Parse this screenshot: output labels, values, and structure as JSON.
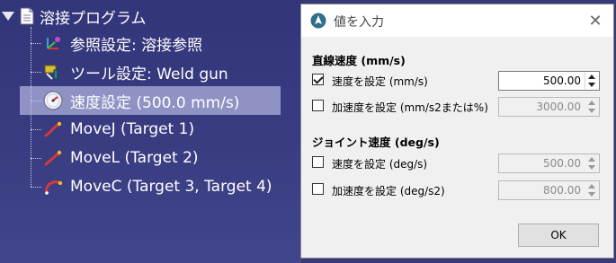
{
  "tree": {
    "root_label": "溶接プログラム",
    "items": [
      {
        "label": "参照設定: 溶接参照",
        "icon": "reference-frame-icon"
      },
      {
        "label": "ツール設定: Weld gun",
        "icon": "tool-icon"
      },
      {
        "label": "速度設定 (500.0 mm/s)",
        "icon": "speed-gauge-icon",
        "selected": true
      },
      {
        "label": "MoveJ (Target 1)",
        "icon": "movej-icon"
      },
      {
        "label": "MoveL (Target 2)",
        "icon": "movel-icon"
      },
      {
        "label": "MoveC (Target 3, Target 4)",
        "icon": "movec-icon"
      }
    ]
  },
  "dialog": {
    "title": "値を入力",
    "close_glyph": "✕",
    "linear_section": "直線速度 (mm/s)",
    "joint_section": "ジョイント速度 (deg/s)",
    "rows": [
      {
        "label": "速度を設定 (mm/s)",
        "checked": true,
        "value": "500.00"
      },
      {
        "label": "加速度を設定 (mm/s2または%)",
        "checked": false,
        "value": "3000.00"
      },
      {
        "label": "速度を設定 (deg/s)",
        "checked": false,
        "value": "500.00"
      },
      {
        "label": "加速度を設定 (deg/s2)",
        "checked": false,
        "value": "800.00"
      }
    ],
    "ok_label": "OK"
  },
  "colors": {
    "tree_bg": "#373a78",
    "selection": "#8f93c4",
    "dialog_bg": "#f0f0f0"
  }
}
